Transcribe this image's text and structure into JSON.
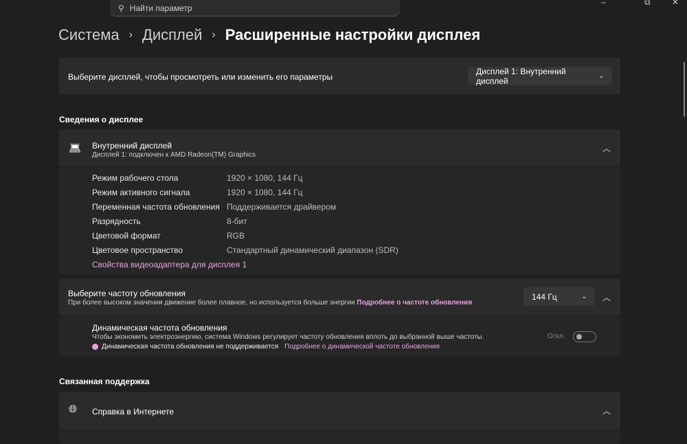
{
  "search": {
    "placeholder": "Найти параметр"
  },
  "window": {
    "minimize": "–",
    "restore": "⧉",
    "close": "✕"
  },
  "breadcrumb": {
    "items": [
      "Система",
      "Дисплей"
    ],
    "current": "Расширенные настройки дисплея"
  },
  "display_select": {
    "label": "Выберите дисплей, чтобы просмотреть или изменить его параметры",
    "value": "Дисплей 1: Внутренний дисплей"
  },
  "info_section": {
    "title": "Сведения о дисплее",
    "name": "Внутренний дисплей",
    "subtitle": "Дисплей 1: подключен к AMD Radeon(TM) Graphics",
    "rows": [
      {
        "k": "Режим рабочего стола",
        "v": "1920 × 1080, 144 Гц"
      },
      {
        "k": "Режим активного сигнала",
        "v": "1920 × 1080, 144 Гц"
      },
      {
        "k": "Переменная частота обновления",
        "v": "Поддерживается драйвером"
      },
      {
        "k": "Разрядность",
        "v": "8-бит"
      },
      {
        "k": "Цветовой формат",
        "v": "RGB"
      },
      {
        "k": "Цветовое пространство",
        "v": "Стандартный динамический диапазон (SDR)"
      }
    ],
    "adapter_link": "Свойства видеоадаптера для дисплея 1"
  },
  "refresh": {
    "title": "Выберите частоту обновления",
    "desc": "При более высоком значении движение более плавное, но используется больше энергии",
    "link": "Подробнее о частоте обновления",
    "value": "144 Гц",
    "dynamic_title": "Динамическая частота обновления",
    "dynamic_desc": "Чтобы экономить электроэнергию, система Windows регулирует частоту обновления вплоть до выбранной выше частоты.",
    "warning": "Динамическая частота обновления не поддерживается",
    "dynamic_link": "Подробнее о динамической частоте обновления",
    "toggle_label": "Откл."
  },
  "support": {
    "title": "Связанная поддержка",
    "help": "Справка в Интернете"
  },
  "colors": {
    "accent": "#e7a3de",
    "bg": "#1f1f1f",
    "card": "#2b2b2b"
  }
}
